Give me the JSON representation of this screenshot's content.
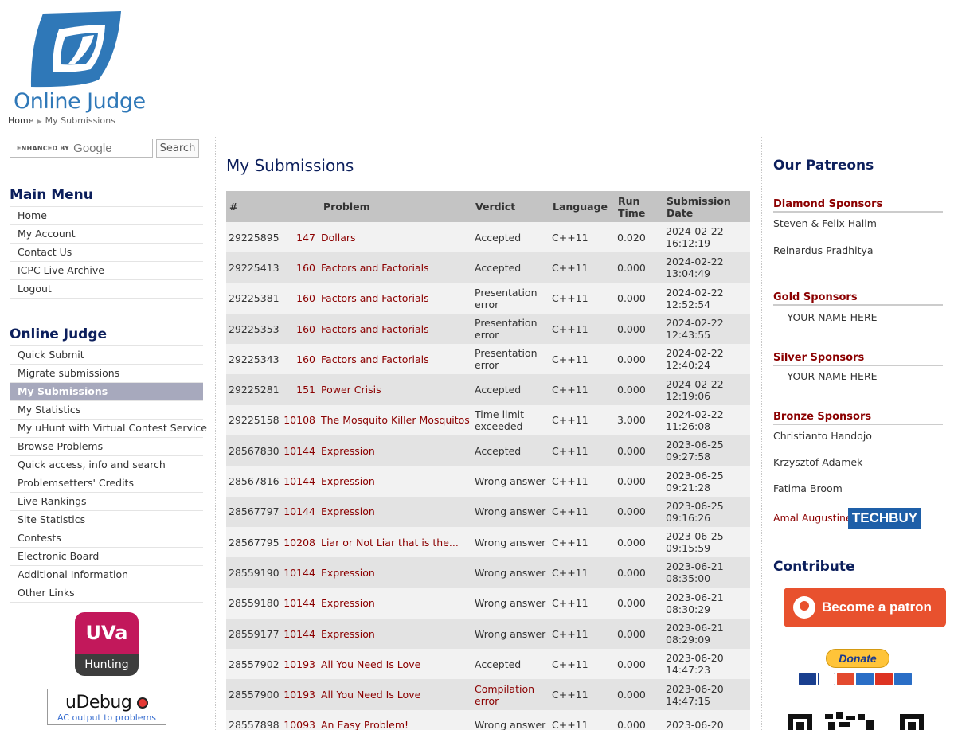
{
  "site": {
    "name": "Online Judge"
  },
  "breadcrumb": {
    "home": "Home",
    "current": "My Submissions"
  },
  "search": {
    "enhanced_by": "ENHANCED BY",
    "google": "Google",
    "button": "Search"
  },
  "main_menu": {
    "title": "Main Menu",
    "items": [
      "Home",
      "My Account",
      "Contact Us",
      "ICPC Live Archive",
      "Logout"
    ]
  },
  "online_judge_menu": {
    "title": "Online Judge",
    "active": "My Submissions",
    "items": [
      "Quick Submit",
      "Migrate submissions",
      "My Submissions",
      "My Statistics",
      "My uHunt with Virtual Contest Service",
      "Browse Problems",
      "Quick access, info and search",
      "Problemsetters' Credits",
      "Live Rankings",
      "Site Statistics",
      "Contests",
      "Electronic Board",
      "Additional Information",
      "Other Links"
    ]
  },
  "badges": {
    "uva_top": "UVa",
    "uva_bottom": "Hunting",
    "udebug": "uDebug",
    "udebug_tag": "AC output to problems"
  },
  "page_title": "My Submissions",
  "table": {
    "headers": {
      "id": "#",
      "problem": "Problem",
      "verdict": "Verdict",
      "language": "Language",
      "run_time": "Run Time",
      "date": "Submission Date"
    },
    "rows": [
      {
        "id": "29225895",
        "pid": "147",
        "name": "Dollars",
        "verdict": "Accepted",
        "lang": "C++11",
        "time": "0.020",
        "date": "2024-02-22 16:12:19"
      },
      {
        "id": "29225413",
        "pid": "160",
        "name": "Factors and Factorials",
        "verdict": "Accepted",
        "lang": "C++11",
        "time": "0.000",
        "date": "2024-02-22 13:04:49"
      },
      {
        "id": "29225381",
        "pid": "160",
        "name": "Factors and Factorials",
        "verdict": "Presentation error",
        "lang": "C++11",
        "time": "0.000",
        "date": "2024-02-22 12:52:54"
      },
      {
        "id": "29225353",
        "pid": "160",
        "name": "Factors and Factorials",
        "verdict": "Presentation error",
        "lang": "C++11",
        "time": "0.000",
        "date": "2024-02-22 12:43:55"
      },
      {
        "id": "29225343",
        "pid": "160",
        "name": "Factors and Factorials",
        "verdict": "Presentation error",
        "lang": "C++11",
        "time": "0.000",
        "date": "2024-02-22 12:40:24"
      },
      {
        "id": "29225281",
        "pid": "151",
        "name": "Power Crisis",
        "verdict": "Accepted",
        "lang": "C++11",
        "time": "0.000",
        "date": "2024-02-22 12:19:06"
      },
      {
        "id": "29225158",
        "pid": "10108",
        "name": "The Mosquito Killer Mosquitos",
        "verdict": "Time limit exceeded",
        "lang": "C++11",
        "time": "3.000",
        "date": "2024-02-22 11:26:08"
      },
      {
        "id": "28567830",
        "pid": "10144",
        "name": "Expression",
        "verdict": "Accepted",
        "lang": "C++11",
        "time": "0.000",
        "date": "2023-06-25 09:27:58"
      },
      {
        "id": "28567816",
        "pid": "10144",
        "name": "Expression",
        "verdict": "Wrong answer",
        "lang": "C++11",
        "time": "0.000",
        "date": "2023-06-25 09:21:28"
      },
      {
        "id": "28567797",
        "pid": "10144",
        "name": "Expression",
        "verdict": "Wrong answer",
        "lang": "C++11",
        "time": "0.000",
        "date": "2023-06-25 09:16:26"
      },
      {
        "id": "28567795",
        "pid": "10208",
        "name": "Liar or Not Liar that is the...",
        "verdict": "Wrong answer",
        "lang": "C++11",
        "time": "0.000",
        "date": "2023-06-25 09:15:59"
      },
      {
        "id": "28559190",
        "pid": "10144",
        "name": "Expression",
        "verdict": "Wrong answer",
        "lang": "C++11",
        "time": "0.000",
        "date": "2023-06-21 08:35:00"
      },
      {
        "id": "28559180",
        "pid": "10144",
        "name": "Expression",
        "verdict": "Wrong answer",
        "lang": "C++11",
        "time": "0.000",
        "date": "2023-06-21 08:30:29"
      },
      {
        "id": "28559177",
        "pid": "10144",
        "name": "Expression",
        "verdict": "Wrong answer",
        "lang": "C++11",
        "time": "0.000",
        "date": "2023-06-21 08:29:09"
      },
      {
        "id": "28557902",
        "pid": "10193",
        "name": "All You Need Is Love",
        "verdict": "Accepted",
        "lang": "C++11",
        "time": "0.000",
        "date": "2023-06-20 14:47:23"
      },
      {
        "id": "28557900",
        "pid": "10193",
        "name": "All You Need Is Love",
        "verdict": "Compilation error",
        "lang": "C++11",
        "time": "0.000",
        "date": "2023-06-20 14:47:15"
      },
      {
        "id": "28557898",
        "pid": "10093",
        "name": "An Easy Problem!",
        "verdict": "Wrong answer",
        "lang": "C++11",
        "time": "0.000",
        "date": "2023-06-20"
      }
    ]
  },
  "patreons": {
    "title": "Our Patreons",
    "diamond_title": "Diamond Sponsors",
    "diamond": [
      "Steven & Felix Halim",
      "Reinardus Pradhitya"
    ],
    "gold_title": "Gold Sponsors",
    "gold": "--- YOUR NAME HERE ----",
    "silver_title": "Silver Sponsors",
    "silver": "--- YOUR NAME HERE ----",
    "bronze_title": "Bronze Sponsors",
    "bronze": [
      "Christianto Handojo",
      "Krzysztof Adamek",
      "Fatima Broom",
      "Amal Augustine"
    ],
    "techbuy": "TECHBUY"
  },
  "contribute": {
    "title": "Contribute",
    "patron_button": "Become a patron",
    "donate": "Donate"
  },
  "colors": {
    "accent_navy": "#0c1f5c",
    "link_red": "#8b0000",
    "logo_blue": "#2f78b8",
    "active_menu": "#a7a9bd",
    "patreon_orange": "#e8512e"
  }
}
